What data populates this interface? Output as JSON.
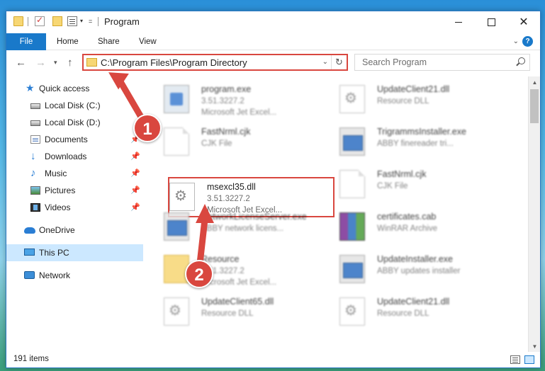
{
  "window": {
    "title": "Program",
    "qa_dropdown": "▾",
    "qa_eq": "="
  },
  "ribbon": {
    "tabs": [
      "File",
      "Home",
      "Share",
      "View"
    ],
    "collapse": "⌄",
    "help": "?"
  },
  "controls": {
    "back": "←",
    "forward": "→",
    "recent": "▾",
    "up": "↑",
    "minimize": "",
    "maximize": "",
    "close": "✕"
  },
  "address": {
    "path": "C:\\Program Files\\Program Directory",
    "dropdown": "⌄",
    "refresh": "↻"
  },
  "search": {
    "placeholder": "Search Program"
  },
  "sidebar": {
    "items": [
      {
        "label": "Quick access",
        "icon": "star-icon",
        "pinned": false
      },
      {
        "label": "Local Disk (C:)",
        "icon": "disk-icon",
        "pinned": false
      },
      {
        "label": "Local Disk (D:)",
        "icon": "disk-icon",
        "pinned": false
      },
      {
        "label": "Documents",
        "icon": "documents-icon",
        "pinned": true
      },
      {
        "label": "Downloads",
        "icon": "download-icon",
        "pinned": true
      },
      {
        "label": "Music",
        "icon": "music-icon",
        "pinned": true
      },
      {
        "label": "Pictures",
        "icon": "pictures-icon",
        "pinned": true
      },
      {
        "label": "Videos",
        "icon": "videos-icon",
        "pinned": true
      },
      {
        "label": "OneDrive",
        "icon": "onedrive-icon",
        "pinned": false
      },
      {
        "label": "This PC",
        "icon": "this-pc-icon",
        "pinned": false,
        "selected": true
      },
      {
        "label": "Network",
        "icon": "network-icon",
        "pinned": false
      }
    ],
    "pin_glyph": "📌"
  },
  "files": [
    {
      "name": "program.exe",
      "line2": "3.51.3227.2",
      "line3": "Microsoft Jet Excel...",
      "icon": "program-icon"
    },
    {
      "name": "UpdateClient21.dll",
      "line2": "Resource DLL",
      "line3": "",
      "icon": "dll-icon"
    },
    {
      "name": "FastNrml.cjk",
      "line2": "CJK File",
      "line3": "",
      "icon": "document-icon"
    },
    {
      "name": "TrigrammsInstaller.exe",
      "line2": "ABBY finereader tri...",
      "line3": "",
      "icon": "exe-icon"
    },
    {
      "name": "msexcl35.dll",
      "line2": "3.51.3227.2",
      "line3": "Microsoft Jet Excel...",
      "icon": "dll-icon",
      "highlighted": true
    },
    {
      "name": "FastNrml.cjk",
      "line2": "CJK File",
      "line3": "",
      "icon": "document-icon"
    },
    {
      "name": "NetworkLicenseServer.exe",
      "line2": "ABBY network licens...",
      "line3": "",
      "icon": "exe-icon"
    },
    {
      "name": "certificates.cab",
      "line2": "WinRAR Archive",
      "line3": "",
      "icon": "winrar-icon"
    },
    {
      "name": "Resource",
      "line2": "3.51.3227.2",
      "line3": "Microsoft Jet Excel...",
      "icon": "folder-file-icon"
    },
    {
      "name": "UpdateInstaller.exe",
      "line2": "ABBY updates installer",
      "line3": "",
      "icon": "exe-icon"
    },
    {
      "name": "UpdateClient65.dll",
      "line2": "Resource DLL",
      "line3": "",
      "icon": "dll-icon"
    },
    {
      "name": "UpdateClient21.dll",
      "line2": "Resource DLL",
      "line3": "",
      "icon": "dll-icon"
    }
  ],
  "scroll": {
    "up": "▲",
    "down": "▼"
  },
  "status": {
    "item_count": "191 items"
  },
  "annotations": {
    "badge1": "1",
    "badge2": "2"
  },
  "colors": {
    "accent": "#1979ca",
    "highlight": "#d9473f",
    "selection": "#cce8ff"
  }
}
